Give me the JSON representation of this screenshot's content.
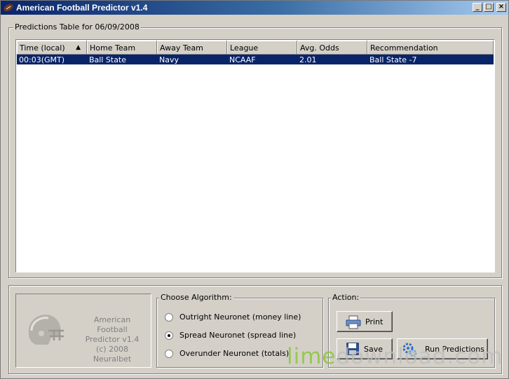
{
  "window": {
    "title": "American Football Predictor v1.4"
  },
  "predictions": {
    "label": "Predictions Table for 06/09/2008",
    "columns": [
      "Time (local)",
      "Home Team",
      "Away Team",
      "League",
      "Avg. Odds",
      "Recommendation"
    ],
    "rows": [
      {
        "time": "00:03(GMT)",
        "home": "Ball State",
        "away": "Navy",
        "league": "NCAAF",
        "odds": "2.01",
        "recommendation": "Ball State -7"
      }
    ]
  },
  "about": {
    "line1": "American Football",
    "line2": "Predictor v1.4",
    "line3": "(c) 2008 Neuralbet"
  },
  "algorithm": {
    "label": "Choose Algorithm:",
    "options": [
      {
        "label": "Outright  Neuronet  (money line)",
        "selected": false
      },
      {
        "label": "Spread  Neuronet  (spread line)",
        "selected": true
      },
      {
        "label": "Overunder  Neuronet  (totals)",
        "selected": false
      }
    ]
  },
  "action": {
    "label": "Action:",
    "print": "Print",
    "save": "Save",
    "run": "Run Predictions"
  },
  "watermark": {
    "part1": "lime",
    "part2": "download.com"
  }
}
